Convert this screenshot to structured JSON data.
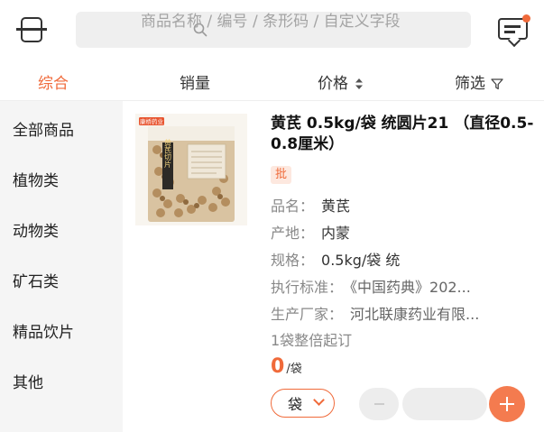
{
  "search": {
    "placeholder": "商品名称 / 编号 / 条形码 / 自定义字段"
  },
  "sort_tabs": [
    {
      "label": "综合",
      "active": true
    },
    {
      "label": "销量",
      "active": false
    },
    {
      "label": "价格",
      "active": false
    },
    {
      "label": "筛选",
      "active": false
    }
  ],
  "categories": [
    {
      "label": "全部商品"
    },
    {
      "label": "植物类"
    },
    {
      "label": "动物类"
    },
    {
      "label": "矿石类"
    },
    {
      "label": "精品饮片"
    },
    {
      "label": "其他"
    }
  ],
  "product": {
    "title": "黄芪 0.5kg/袋 统圆片21 （直径0.5-0.8厘米）",
    "badge": "批",
    "attributes": [
      {
        "label": "品名：",
        "value": "黄芪"
      },
      {
        "label": "产地：",
        "value": "内蒙"
      },
      {
        "label": "规格：",
        "value": "0.5kg/袋 统"
      },
      {
        "label": "执行标准：",
        "value": "《中国药典》202..."
      },
      {
        "label": "生产厂家：",
        "value": "河北联康药业有限..."
      }
    ],
    "order_note": "1袋整倍起订",
    "price": "0",
    "price_unit": "/袋",
    "unit_option": "袋",
    "image_brand": "康桥药业",
    "image_label": "黄芪切片"
  },
  "colors": {
    "accent": "#f06a3a",
    "sidebar_bg": "#f5f5f5"
  },
  "icons": [
    "scan-icon",
    "search-icon",
    "message-icon",
    "sort-arrows-icon",
    "filter-icon",
    "chevron-down-icon",
    "minus-icon",
    "plus-icon"
  ]
}
